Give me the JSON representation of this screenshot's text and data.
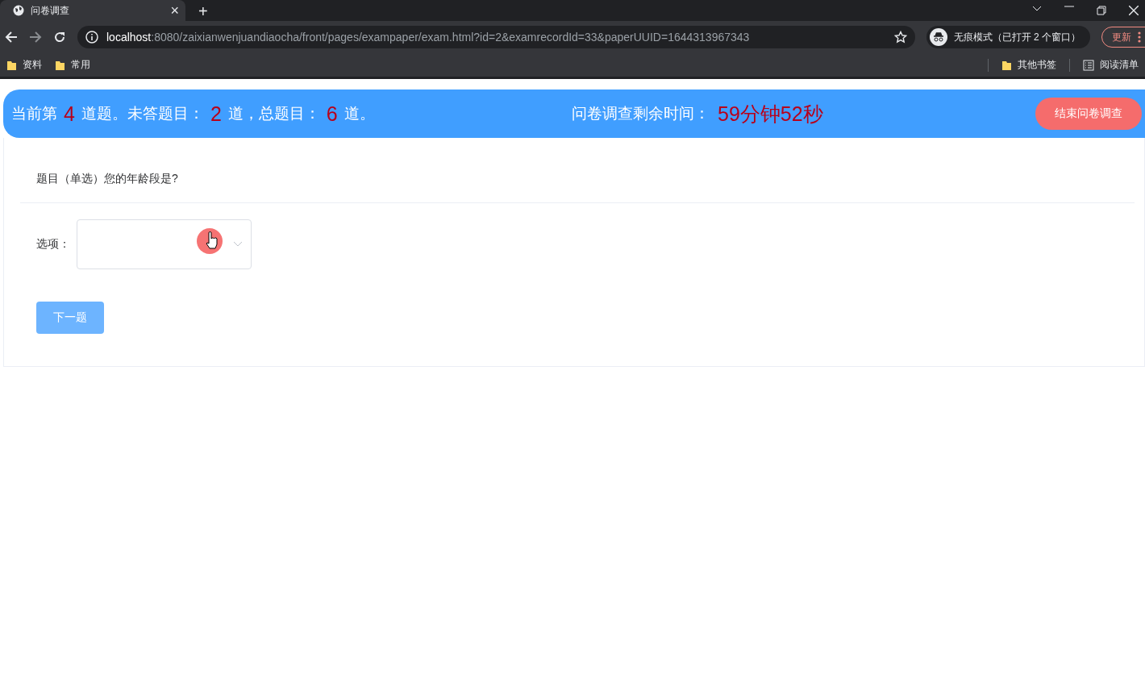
{
  "browser": {
    "tab": {
      "title": "问卷调查",
      "close": "×"
    },
    "new_tab": "+",
    "url": {
      "host": "localhost",
      "rest": ":8080/zaixianwenjuandiaocha/front/pages/exampaper/exam.html?id=2&examrecordId=33&paperUUID=1644313967343"
    },
    "incognito": "无痕模式（已打开 2 个窗口）",
    "update_button": "更新",
    "bookmarks": [
      {
        "label": "资料",
        "kind": "folder"
      },
      {
        "label": "常用",
        "kind": "folder"
      }
    ],
    "bookmarks_right": [
      {
        "label": "其他书签",
        "kind": "folder"
      },
      {
        "label": "阅读清单",
        "kind": "list"
      }
    ]
  },
  "header": {
    "progress": [
      {
        "kind": "text",
        "text": "当前第"
      },
      {
        "kind": "number",
        "text": "4"
      },
      {
        "kind": "text",
        "text": "道题。未答题目："
      },
      {
        "kind": "number",
        "text": "2"
      },
      {
        "kind": "text",
        "text": "道，总题目："
      },
      {
        "kind": "number",
        "text": "6"
      },
      {
        "kind": "text",
        "text": "道。"
      }
    ],
    "timer_label": "问卷调查剩余时间：",
    "timer_value": "59分钟52秒",
    "end_button": "结束问卷调查"
  },
  "question": {
    "title": "题目（单选）您的年龄段是?",
    "option_label": "选项：",
    "next_button": {
      "label": "下一题",
      "disabled": true
    }
  }
}
